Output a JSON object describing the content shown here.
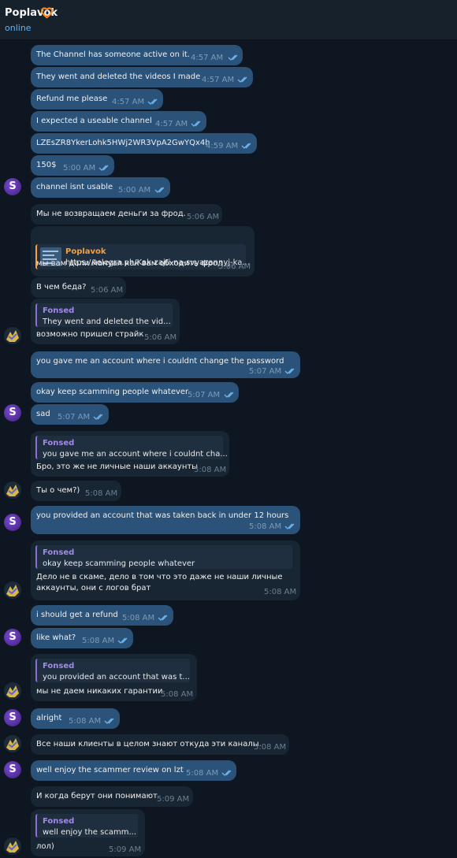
{
  "header": {
    "title": "Poplavok",
    "status": "online",
    "heart_color": "#f08a24"
  },
  "colors": {
    "background": "#0e1621",
    "outgoing_bubble": "#2b5278",
    "incoming_bubble": "#182533",
    "quote_accent": "#a18ae8",
    "link_accent": "#f6a03d"
  },
  "avatars": {
    "me_glyph": "S"
  },
  "messages": [
    {
      "dir": "out",
      "text": "The Channel has someone active on it.",
      "time": "4:57 AM",
      "read": true
    },
    {
      "dir": "out",
      "text": "They went and deleted the videos I made",
      "time": "4:57 AM",
      "read": true
    },
    {
      "dir": "out",
      "text": "Refund me please",
      "time": "4:57 AM",
      "read": true
    },
    {
      "dir": "out",
      "text": "I expected a useable channel",
      "time": "4:57 AM",
      "read": true
    },
    {
      "dir": "out",
      "text": "LZEsZR8YkerLohk5HWj2WR3VpA2GwYQx4h",
      "time": "4:59 AM",
      "read": true
    },
    {
      "dir": "out",
      "text": "150$",
      "time": "5:00 AM",
      "read": true
    },
    {
      "dir": "out",
      "text": "channel isnt usable",
      "time": "5:00 AM",
      "read": true
    },
    {
      "dir": "in",
      "text": "Мы не возвращаем деньги за фрод.",
      "time": "5:06 AM"
    },
    {
      "dir": "in",
      "text": "мы вам дали мануал как вам обходить фрод",
      "time": "5:06 AM",
      "link_preview": {
        "site": "Poplavok",
        "url": "https://telegra.ph/Kak-zajti-na-svyazannyj-ka..."
      }
    },
    {
      "dir": "in",
      "text": "В чем беда?",
      "time": "5:06 AM"
    },
    {
      "dir": "in",
      "text": "возможно пришел страйк",
      "time": "5:06 AM",
      "reply": {
        "name": "Fonsed",
        "text": "They went and deleted the vid..."
      }
    },
    {
      "dir": "out",
      "text": "you gave me an account where i couldnt change the password",
      "time": "5:07 AM",
      "read": true
    },
    {
      "dir": "out",
      "text": "okay keep scamming people whatever",
      "time": "5:07 AM",
      "read": true
    },
    {
      "dir": "out",
      "text": "sad",
      "time": "5:07 AM",
      "read": true
    },
    {
      "dir": "in",
      "text": "Бро, это же не личные наши аккаунты",
      "time": "5:08 AM",
      "reply": {
        "name": "Fonsed",
        "text": "you gave me an account where i couldnt cha..."
      }
    },
    {
      "dir": "in",
      "text": "Ты о чем?)",
      "time": "5:08 AM"
    },
    {
      "dir": "out",
      "text": "you provided an account that was taken back in under 12 hours",
      "time": "5:08 AM",
      "read": true
    },
    {
      "dir": "in",
      "text": "Дело не в скаме, дело в том что это даже не наши личные",
      "text2": "аккаунты, они с логов брат",
      "time": "5:08 AM",
      "reply": {
        "name": "Fonsed",
        "text": "okay keep scamming people whatever"
      }
    },
    {
      "dir": "out",
      "text": "i should get a refund",
      "time": "5:08 AM",
      "read": true
    },
    {
      "dir": "out",
      "text": "like what?",
      "time": "5:08 AM",
      "read": true
    },
    {
      "dir": "in",
      "text": "мы не даем никаких гарантии",
      "time": "5:08 AM",
      "reply": {
        "name": "Fonsed",
        "text": "you provided an account that was t..."
      }
    },
    {
      "dir": "out",
      "text": "alright",
      "time": "5:08 AM",
      "read": true
    },
    {
      "dir": "in",
      "text": "Все наши клиенты в целом знают откуда эти каналы.",
      "time": "5:08 AM"
    },
    {
      "dir": "out",
      "text": "well enjoy the scammer review on lzt",
      "time": "5:08 AM",
      "read": true
    },
    {
      "dir": "in",
      "text": "И когда берут они понимают",
      "time": "5:09 AM"
    },
    {
      "dir": "in",
      "text": "лол)",
      "time": "5:09 AM",
      "reply": {
        "name": "Fonsed",
        "text": "well enjoy the scamm..."
      }
    }
  ]
}
